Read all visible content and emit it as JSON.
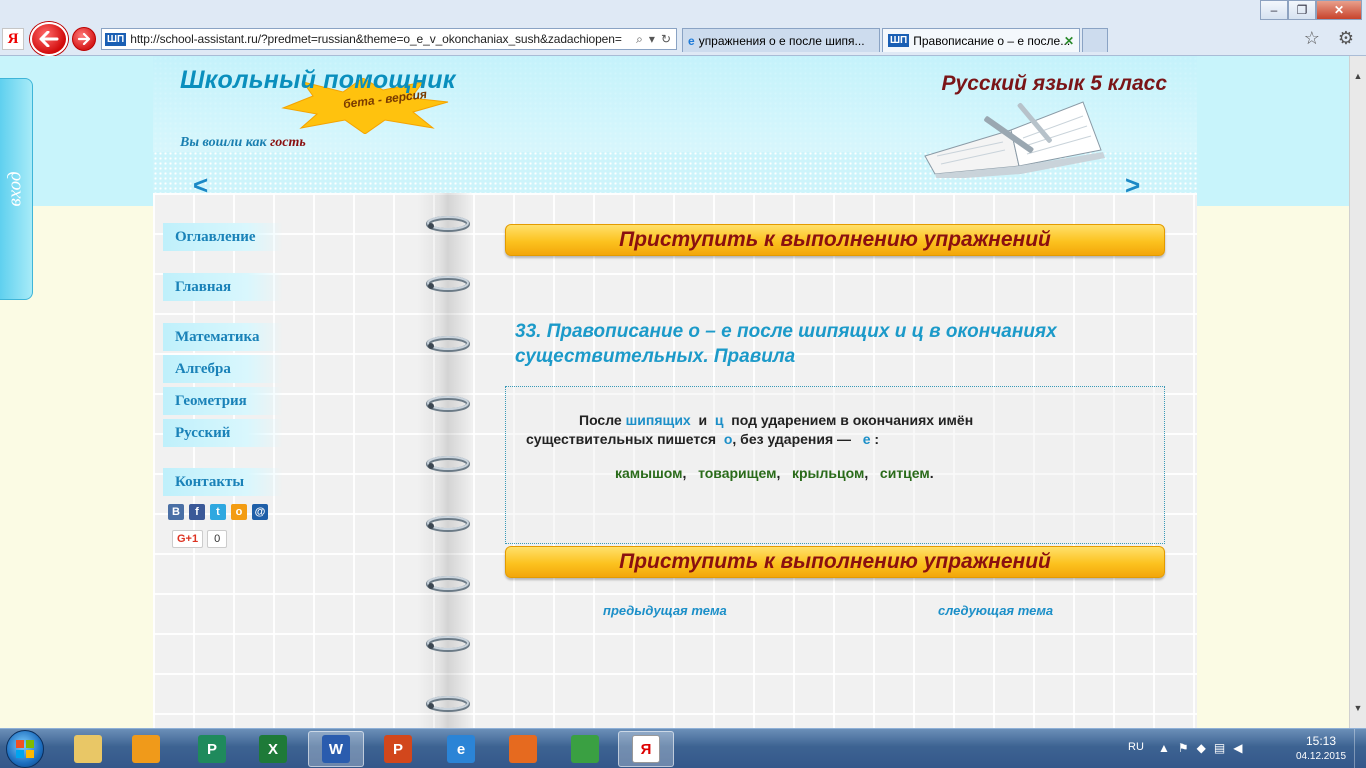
{
  "browser": {
    "address": "http://school-assistant.ru/?predmet=russian&theme=o_e_v_okonchaniax_sush&zadachiopen=",
    "site_tag": "ШП",
    "tabs": [
      {
        "label": "упражнения о е после шипя...",
        "icon": "ie-icon"
      },
      {
        "label": "Правописание о – е после...",
        "icon": "sp-icon",
        "icon_text": "ШП",
        "active": true
      }
    ],
    "window_controls": {
      "minimize": "‒",
      "maximize": "❐",
      "close": "✕"
    },
    "yandex_logo": "Я"
  },
  "side": {
    "login_tab": "вход"
  },
  "header": {
    "logo": "Школьный помощник",
    "beta": "бета - версия",
    "logged_in_prefix": "Вы вошли как",
    "logged_in_user": "гость",
    "subject": "Русский язык 5 класс",
    "prev_arrow": "<",
    "next_arrow": ">"
  },
  "menu": {
    "items": [
      "Оглавление",
      "Главная",
      "Математика",
      "Алгебра",
      "Геометрия",
      "Русский",
      "Контакты"
    ]
  },
  "social": {
    "icons": [
      {
        "name": "vk-icon",
        "label": "В",
        "color": "#4a6fa5"
      },
      {
        "name": "facebook-icon",
        "label": "f",
        "color": "#3b5998"
      },
      {
        "name": "twitter-icon",
        "label": "t",
        "color": "#2fa8e0"
      },
      {
        "name": "odnoklassniki-icon",
        "label": "о",
        "color": "#f39c12"
      },
      {
        "name": "mailru-icon",
        "label": "@",
        "color": "#1f5fa8"
      }
    ],
    "gplus_label": "G+1",
    "gplus_count": "0"
  },
  "main": {
    "start_button": "Приступить к выполнению упражнений",
    "lesson_title": "33. Правописание о – е после шипящих и ц в окончаниях существительных. Правила",
    "rule": {
      "p1": "После",
      "w_shipyashchih": "шипящих",
      "p2": "и",
      "w_ts": "ц",
      "p3": "под ударением в окончаниях имён",
      "p4": "существительных пишется",
      "w_o": "о",
      "p5": ",   без ударения —",
      "w_e": "е",
      "p6": ":"
    },
    "examples": [
      "камышом",
      "товарищем",
      "крыльцом",
      "ситцем"
    ],
    "prev_topic": "предыдущая тема",
    "next_topic": "следующая тема"
  },
  "taskbar": {
    "apps": [
      {
        "name": "explorer-icon",
        "color": "#e9c766"
      },
      {
        "name": "media-player-icon",
        "color": "#f09a1a"
      },
      {
        "name": "publisher-icon",
        "color": "#1f8a5c",
        "letter": "P"
      },
      {
        "name": "excel-icon",
        "color": "#1e7a38",
        "letter": "X"
      },
      {
        "name": "word-icon",
        "color": "#2a5cae",
        "letter": "W",
        "active": true
      },
      {
        "name": "powerpoint-icon",
        "color": "#d2471c",
        "letter": "P"
      },
      {
        "name": "ie-icon",
        "color": "#2b84d6",
        "letter": "e"
      },
      {
        "name": "firefox-icon",
        "color": "#e66a1f"
      },
      {
        "name": "stats-icon",
        "color": "#3aa042"
      },
      {
        "name": "yandex-browser-icon",
        "color": "#ffffff",
        "letter": "Я",
        "active": true
      }
    ],
    "lang": "RU",
    "time": "15:13",
    "date": "04.12.2015"
  }
}
